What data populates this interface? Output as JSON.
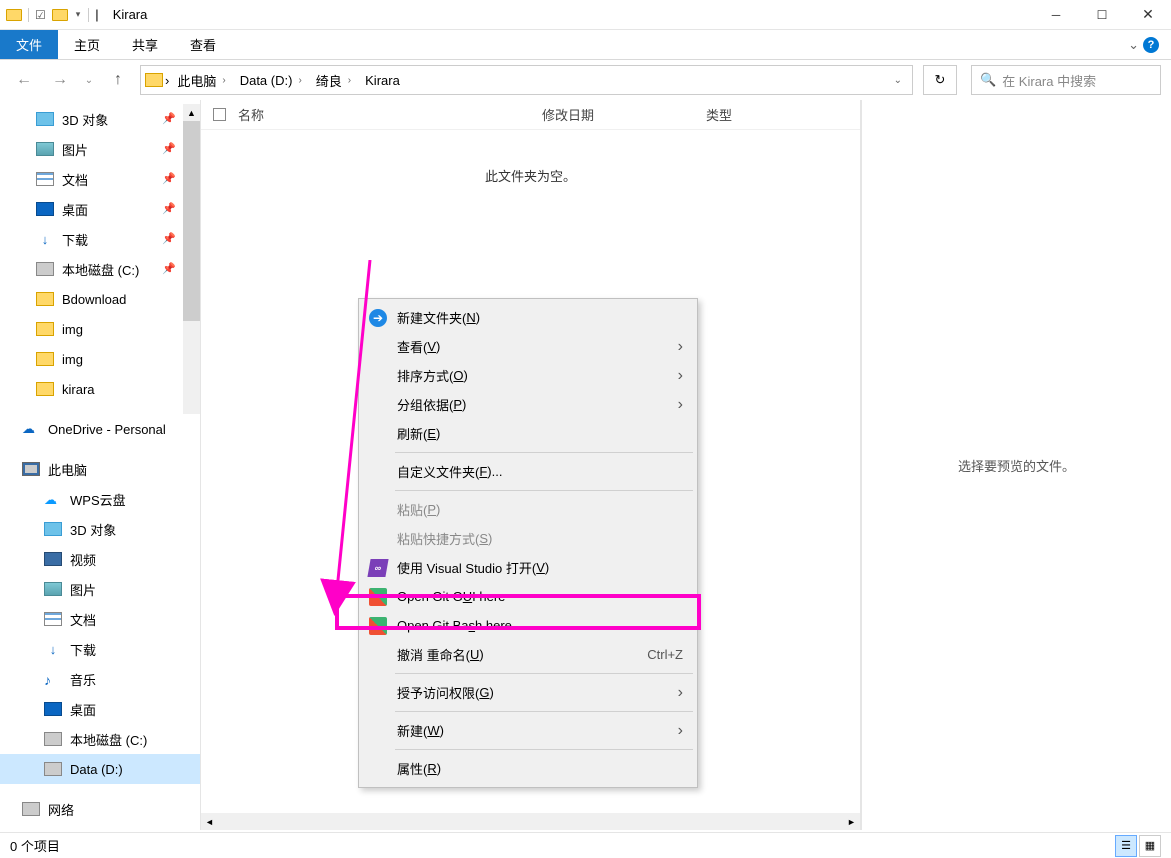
{
  "window": {
    "title": "Kirara",
    "title_sep": "|"
  },
  "ribbon": {
    "file": "文件",
    "home": "主页",
    "share": "共享",
    "view": "查看",
    "expand_icon": "⌄"
  },
  "nav": {
    "back": "←",
    "fwd": "→",
    "dd": "⌄",
    "up": "↑"
  },
  "breadcrumb": {
    "crumb0": "此电脑",
    "crumb1": "Data (D:)",
    "crumb2": "绮良",
    "crumb3": "Kirara",
    "chev": "›"
  },
  "refresh": "↻",
  "search": {
    "icon": "🔍",
    "placeholder": "在 Kirara 中搜索"
  },
  "sidebar": {
    "items": [
      {
        "label": "3D 对象",
        "icon": "ico-3d",
        "pinned": true
      },
      {
        "label": "图片",
        "icon": "ico-pic",
        "pinned": true
      },
      {
        "label": "文档",
        "icon": "ico-doc",
        "pinned": true
      },
      {
        "label": "桌面",
        "icon": "ico-desk",
        "pinned": true
      },
      {
        "label": "下载",
        "icon": "ico-dl",
        "pinned": true,
        "glyph": "↓"
      },
      {
        "label": "本地磁盘 (C:)",
        "icon": "ico-disk",
        "pinned": true
      },
      {
        "label": "Bdownload",
        "icon": "ico-fold"
      },
      {
        "label": "img",
        "icon": "ico-fold"
      },
      {
        "label": "img",
        "icon": "ico-fold"
      },
      {
        "label": "kirara",
        "icon": "ico-fold"
      }
    ],
    "onedrive": "OneDrive - Personal",
    "thispc": "此电脑",
    "pcItems": [
      {
        "label": "WPS云盘",
        "icon": "ico-wps",
        "glyph": "☁"
      },
      {
        "label": "3D 对象",
        "icon": "ico-3d"
      },
      {
        "label": "视频",
        "icon": "ico-vid"
      },
      {
        "label": "图片",
        "icon": "ico-pic"
      },
      {
        "label": "文档",
        "icon": "ico-doc"
      },
      {
        "label": "下载",
        "icon": "ico-dl",
        "glyph": "↓"
      },
      {
        "label": "音乐",
        "icon": "ico-music",
        "glyph": "♪"
      },
      {
        "label": "桌面",
        "icon": "ico-desk"
      },
      {
        "label": "本地磁盘 (C:)",
        "icon": "ico-disk"
      },
      {
        "label": "Data (D:)",
        "icon": "ico-disk",
        "sel": true
      }
    ],
    "network": "网络"
  },
  "columns": {
    "name": "名称",
    "date": "修改日期",
    "type": "类型"
  },
  "emptyMsg": "此文件夹为空。",
  "preview": "选择要预览的文件。",
  "ctx": {
    "new_folder_pre": "新建文件夹(",
    "new_folder_key": "N",
    "new_folder_suf": ")",
    "view_pre": "查看(",
    "view_key": "V",
    "view_suf": ")",
    "sort_pre": "排序方式(",
    "sort_key": "O",
    "sort_suf": ")",
    "group_pre": "分组依据(",
    "group_key": "P",
    "group_suf": ")",
    "refresh_pre": "刷新(",
    "refresh_key": "E",
    "refresh_suf": ")",
    "custom_pre": "自定义文件夹(",
    "custom_key": "F",
    "custom_suf": ")...",
    "paste_pre": "粘贴(",
    "paste_key": "P",
    "paste_suf": ")",
    "paste_sc_pre": "粘贴快捷方式(",
    "paste_sc_key": "S",
    "paste_sc_suf": ")",
    "vs_pre": "使用 Visual Studio 打开(",
    "vs_key": "V",
    "vs_suf": ")",
    "git_gui_pre": "Open Git G",
    "git_gui_key": "U",
    "git_gui_suf": "I here",
    "git_bash_pre": "Open Git Ba",
    "git_bash_key": "s",
    "git_bash_suf": "h here",
    "undo_pre": "撤消 重命名(",
    "undo_key": "U",
    "undo_suf": ")",
    "undo_sc": "Ctrl+Z",
    "grant_pre": "授予访问权限(",
    "grant_key": "G",
    "grant_suf": ")",
    "new_pre": "新建(",
    "new_key": "W",
    "new_suf": ")",
    "props_pre": "属性(",
    "props_key": "R",
    "props_suf": ")"
  },
  "status": {
    "text": "0 个项目"
  }
}
